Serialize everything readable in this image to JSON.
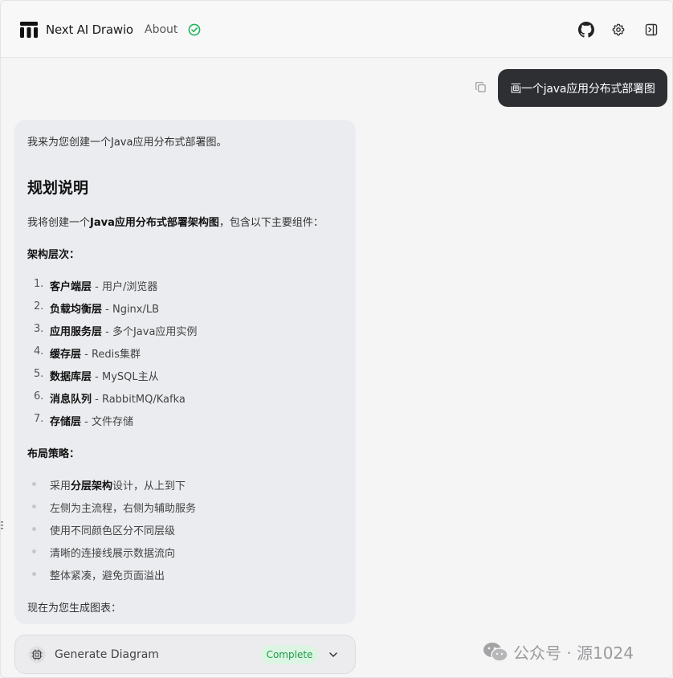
{
  "header": {
    "app_title": "Next AI Drawio",
    "about_label": "About",
    "icons": [
      "logo-icon",
      "check-circle-icon",
      "github-icon",
      "gear-icon",
      "panel-toggle-icon"
    ]
  },
  "user_message": {
    "text": "画一个java应用分布式部署图"
  },
  "assistant_message": {
    "intro": "我来为您创建一个Java应用分布式部署图。",
    "heading": "规划说明",
    "plan_prefix": "我将创建一个",
    "plan_bold": "Java应用分布式部署架构图",
    "plan_suffix": "，包含以下主要组件：",
    "layers_title": "架构层次：",
    "layers": [
      {
        "num": "1.",
        "name": "客户端层",
        "desc": " - 用户/浏览器"
      },
      {
        "num": "2.",
        "name": "负载均衡层",
        "desc": " - Nginx/LB"
      },
      {
        "num": "3.",
        "name": "应用服务层",
        "desc": " - 多个Java应用实例"
      },
      {
        "num": "4.",
        "name": "缓存层",
        "desc": " - Redis集群"
      },
      {
        "num": "5.",
        "name": "数据库层",
        "desc": " - MySQL主从"
      },
      {
        "num": "6.",
        "name": "消息队列",
        "desc": " - RabbitMQ/Kafka"
      },
      {
        "num": "7.",
        "name": "存储层",
        "desc": " - 文件存储"
      }
    ],
    "strategy_title": "布局策略：",
    "strategy_1_prefix": "采用",
    "strategy_1_bold": "分层架构",
    "strategy_1_suffix": "设计，从上到下",
    "strategy_2": "左侧为主流程，右侧为辅助服务",
    "strategy_3": "使用不同颜色区分不同层级",
    "strategy_4": "清晰的连接线展示数据流向",
    "strategy_5": "整体紧凑，避免页面溢出",
    "closing": "现在为您生成图表："
  },
  "tool_call": {
    "label": "Generate Diagram",
    "status": "Complete"
  },
  "watermark": {
    "text": "公众号 · 源1024"
  },
  "colors": {
    "user_bubble": "#2d2f33",
    "status_green": "#1e9a47",
    "status_bg": "#dcf5e3",
    "check_green": "#22b35e"
  }
}
